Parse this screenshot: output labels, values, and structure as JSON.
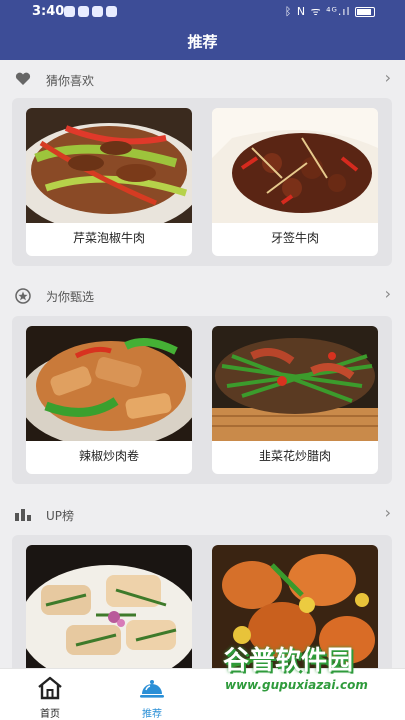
{
  "status_bar": {
    "time": "3:40",
    "system_text": "ᛒ N ᯤ ⁴ᴳ.ıl"
  },
  "header": {
    "title": "推荐"
  },
  "sections": [
    {
      "icon": "heart-icon",
      "label": "猜你喜欢",
      "cards": [
        {
          "name": "芹菜泡椒牛肉",
          "photo": "stir-fried beef with celery and peppers"
        },
        {
          "name": "牙签牛肉",
          "photo": "toothpick beef with chili"
        }
      ]
    },
    {
      "icon": "star-badge-icon",
      "label": "为你甄选",
      "cards": [
        {
          "name": "辣椒炒肉卷",
          "photo": "pork rolls stir-fried with green peppers"
        },
        {
          "name": "韭菜花炒腊肉",
          "photo": "cured pork with chive flowers"
        }
      ]
    },
    {
      "icon": "bar-chart-icon",
      "label": "UP榜",
      "cards": [
        {
          "name": "",
          "photo": "crispy fried fish with herbs"
        },
        {
          "name": "",
          "photo": "braised chicken with potatoes"
        }
      ]
    }
  ],
  "tabbar": {
    "tabs": [
      {
        "label": "首页",
        "icon": "home-icon",
        "active": false
      },
      {
        "label": "推荐",
        "icon": "cloche-icon",
        "active": true
      }
    ]
  },
  "watermark": {
    "title": "谷普软件园",
    "url": "www.gupuxiazai.com"
  },
  "colors": {
    "header": "#3d4d97",
    "active_tab": "#2a8fd6",
    "watermark": "#2f9b3c"
  }
}
